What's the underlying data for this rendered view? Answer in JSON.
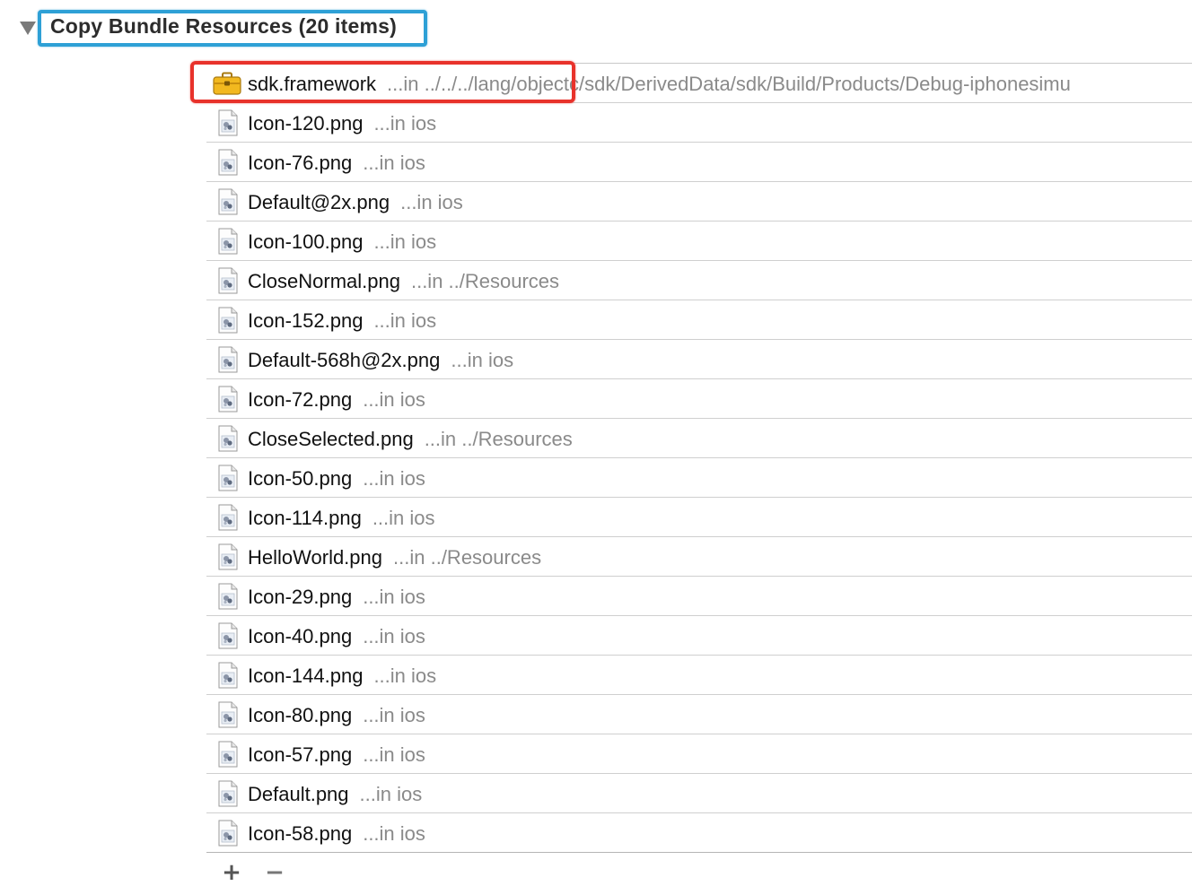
{
  "phase": {
    "title": "Copy Bundle Resources (20 items)",
    "title_box_color": "#2ea0d6"
  },
  "highlight_color": "#e8322b",
  "files": [
    {
      "name": "sdk.framework",
      "location": "...in ../../../lang/objectc/sdk/DerivedData/sdk/Build/Products/Debug-iphonesimu",
      "icon": "framework-toolbox-icon"
    },
    {
      "name": "Icon-120.png",
      "location": "...in ios",
      "icon": "image-file-icon"
    },
    {
      "name": "Icon-76.png",
      "location": "...in ios",
      "icon": "image-file-icon"
    },
    {
      "name": "Default@2x.png",
      "location": "...in ios",
      "icon": "image-file-icon"
    },
    {
      "name": "Icon-100.png",
      "location": "...in ios",
      "icon": "image-file-icon"
    },
    {
      "name": "CloseNormal.png",
      "location": "...in ../Resources",
      "icon": "image-file-icon"
    },
    {
      "name": "Icon-152.png",
      "location": "...in ios",
      "icon": "image-file-icon"
    },
    {
      "name": "Default-568h@2x.png",
      "location": "...in ios",
      "icon": "image-file-icon"
    },
    {
      "name": "Icon-72.png",
      "location": "...in ios",
      "icon": "image-file-icon"
    },
    {
      "name": "CloseSelected.png",
      "location": "...in ../Resources",
      "icon": "image-file-icon"
    },
    {
      "name": "Icon-50.png",
      "location": "...in ios",
      "icon": "image-file-icon"
    },
    {
      "name": "Icon-114.png",
      "location": "...in ios",
      "icon": "image-file-icon"
    },
    {
      "name": "HelloWorld.png",
      "location": "...in ../Resources",
      "icon": "image-file-icon"
    },
    {
      "name": "Icon-29.png",
      "location": "...in ios",
      "icon": "image-file-icon"
    },
    {
      "name": "Icon-40.png",
      "location": "...in ios",
      "icon": "image-file-icon"
    },
    {
      "name": "Icon-144.png",
      "location": "...in ios",
      "icon": "image-file-icon"
    },
    {
      "name": "Icon-80.png",
      "location": "...in ios",
      "icon": "image-file-icon"
    },
    {
      "name": "Icon-57.png",
      "location": "...in ios",
      "icon": "image-file-icon"
    },
    {
      "name": "Default.png",
      "location": "...in ios",
      "icon": "image-file-icon"
    },
    {
      "name": "Icon-58.png",
      "location": "...in ios",
      "icon": "image-file-icon"
    }
  ],
  "toolbar": {
    "add_label": "+",
    "remove_label": "−"
  }
}
